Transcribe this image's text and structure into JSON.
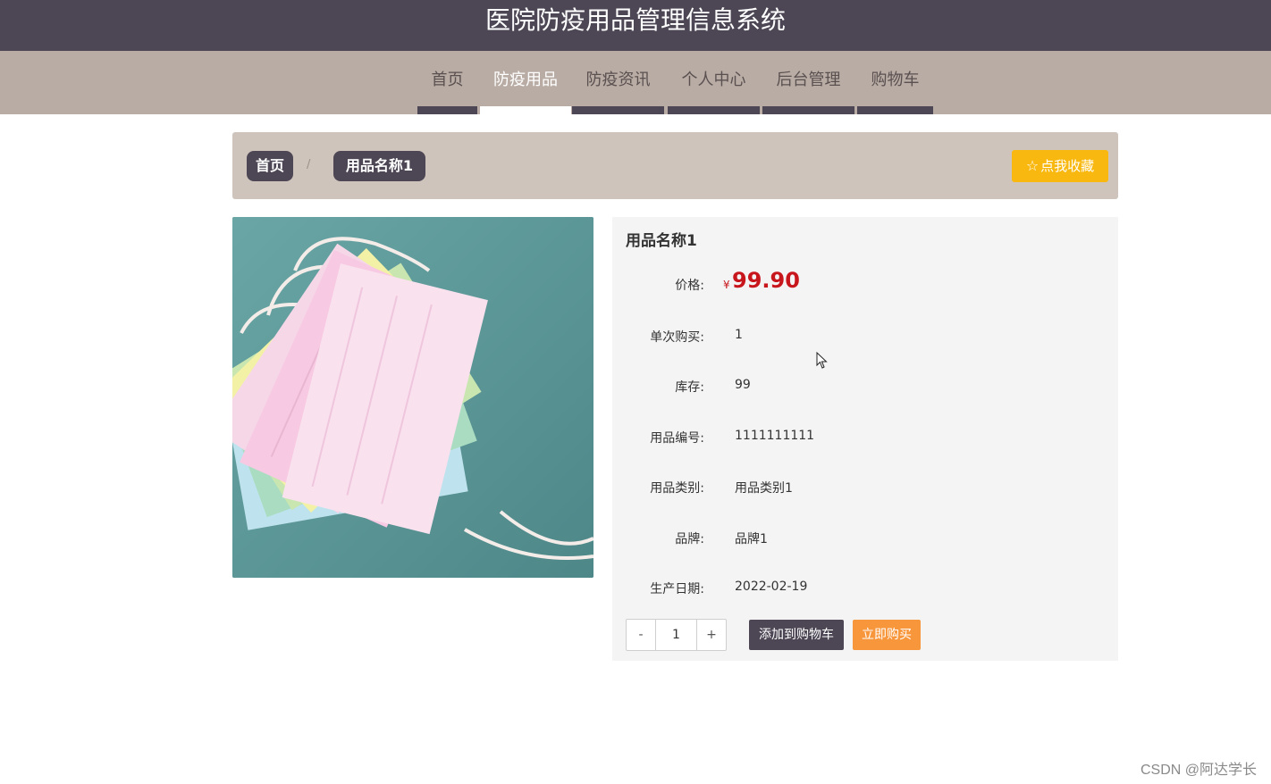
{
  "header": {
    "title": "医院防疫用品管理信息系统"
  },
  "nav": {
    "items": [
      {
        "label": "首页"
      },
      {
        "label": "防疫用品"
      },
      {
        "label": "防疫资讯"
      },
      {
        "label": "个人中心"
      },
      {
        "label": "后台管理"
      },
      {
        "label": "购物车"
      }
    ],
    "active_label": "防疫用品"
  },
  "breadcrumb": {
    "home": "首页",
    "separator": "/",
    "current": "用品名称1",
    "favorite_label": "点我收藏",
    "favorite_icon": "star-outline-icon"
  },
  "product": {
    "image_alt": "surgical masks in assorted colors",
    "name": "用品名称1",
    "price_label": "价格:",
    "currency": "¥",
    "price": "99.90",
    "fields": [
      {
        "label": "单次购买:",
        "value": "1"
      },
      {
        "label": "库存:",
        "value": "99"
      },
      {
        "label": "用品编号:",
        "value": "1111111111"
      },
      {
        "label": "用品类别:",
        "value": "用品类别1"
      },
      {
        "label": "品牌:",
        "value": "品牌1"
      },
      {
        "label": "生产日期:",
        "value": "2022-02-19"
      }
    ]
  },
  "actions": {
    "qty_minus": "-",
    "qty_value": "1",
    "qty_plus": "+",
    "add_to_cart": "添加到购物车",
    "buy_now": "立即购买"
  },
  "watermark": "CSDN @阿达学长",
  "colors": {
    "header_bg": "#4d4654",
    "nav_bg": "#b9aca4",
    "crumb_bg": "#cec4bb",
    "favorite_btn": "#f8b810",
    "price": "#c8161d",
    "buy_btn": "#f7963a"
  }
}
